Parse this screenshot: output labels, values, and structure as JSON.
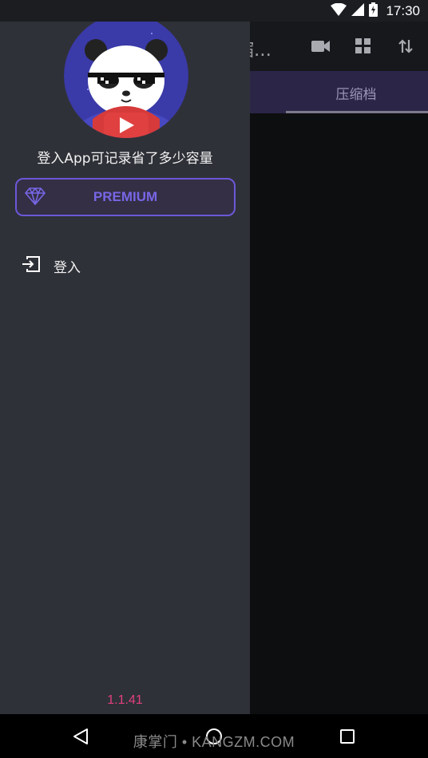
{
  "status_bar": {
    "time": "17:30",
    "icons": [
      "wifi-icon",
      "cell-signal-icon",
      "battery-charging-icon"
    ]
  },
  "app_bar": {
    "title_partial": "缩...",
    "actions": [
      "video-camera-icon",
      "grid-view-icon",
      "sort-icon"
    ]
  },
  "tabs": [
    {
      "label": "压缩档",
      "selected": true
    }
  ],
  "drawer": {
    "avatar": "panda-logo",
    "login_prompt": "登入App可记录省了多少容量",
    "premium_label": "PREMIUM",
    "menu": [
      {
        "icon": "login-icon",
        "label": "登入"
      }
    ],
    "version": "1.1.41"
  },
  "nav_bar": {
    "buttons": [
      "back-icon",
      "home-icon",
      "recents-icon"
    ],
    "watermark": "康掌门 • KANGZM.COM"
  },
  "colors": {
    "drawer_bg": "#2f3138",
    "accent": "#6b58d8",
    "version": "#e2407e",
    "tab_bg": "#2b2548"
  }
}
